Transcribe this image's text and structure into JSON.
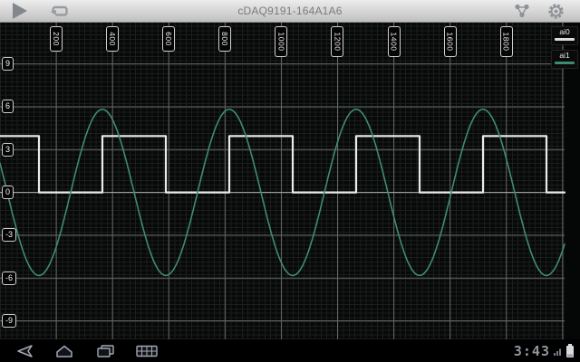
{
  "app": {
    "title": "cDAQ9191-164A1A6"
  },
  "action_bar": {
    "buttons": [
      "play",
      "loop",
      "network-devices",
      "settings"
    ]
  },
  "legend": {
    "items": [
      {
        "label": "ai0",
        "color": "#dcdcdc"
      },
      {
        "label": "ai1",
        "color": "#3e8c70"
      }
    ]
  },
  "status_bar": {
    "time": "3:43"
  },
  "nav_bar": {
    "buttons": [
      "back",
      "home",
      "recent-apps",
      "keyboard"
    ]
  },
  "icons": {
    "play-icon": "triangle-right",
    "loop-icon": "repeat-arrow",
    "network-devices-icon": "three-node-cluster",
    "settings-gear-icon": "gear",
    "back-icon": "arrow-left-outline",
    "home-icon": "house-outline",
    "recent-apps-icon": "stacked-windows-outline",
    "keyboard-icon": "keyboard-grid-outline",
    "signal-icon": "signal-bars",
    "battery-icon": "battery-vertical"
  },
  "colors": {
    "plot_bg": "#070808",
    "grid_minor": "#1a1e1c",
    "grid_major": "#666666",
    "grid_zero": "#b2b2b2",
    "square_wave": "#ebebeb",
    "sine_wave": "#3e8c70"
  },
  "chart_data": {
    "type": "line",
    "title": "",
    "xlabel": "",
    "ylabel": "",
    "x_range": [
      0,
      2007
    ],
    "y_range": [
      -10.3,
      11.96
    ],
    "x_label_ticks": [
      200,
      400,
      600,
      800,
      1000,
      1200,
      1400,
      1600,
      1800
    ],
    "y_label_ticks": [
      9,
      6,
      3,
      0,
      -3,
      -6,
      -9
    ],
    "grid": {
      "minor_x_step": 20,
      "minor_y_step": 0.3,
      "major_x_step": 200,
      "major_y_step": 3,
      "x_extra_gridlines": [
        2000
      ]
    },
    "legend_position": "top-right",
    "series": [
      {
        "name": "ai0",
        "type": "square",
        "color": "#ebebeb",
        "stroke_width": 2.2,
        "high": 3.95,
        "low": 0.0,
        "period": 451,
        "first_fall": 138.5,
        "first_rise": 364
      },
      {
        "name": "ai1",
        "type": "sine",
        "color": "#3e8c70",
        "stroke_width": 1.6,
        "amplitude": 5.82,
        "dc_offset": 0,
        "period": 451,
        "zero_up_crossing": 251.2
      }
    ]
  }
}
